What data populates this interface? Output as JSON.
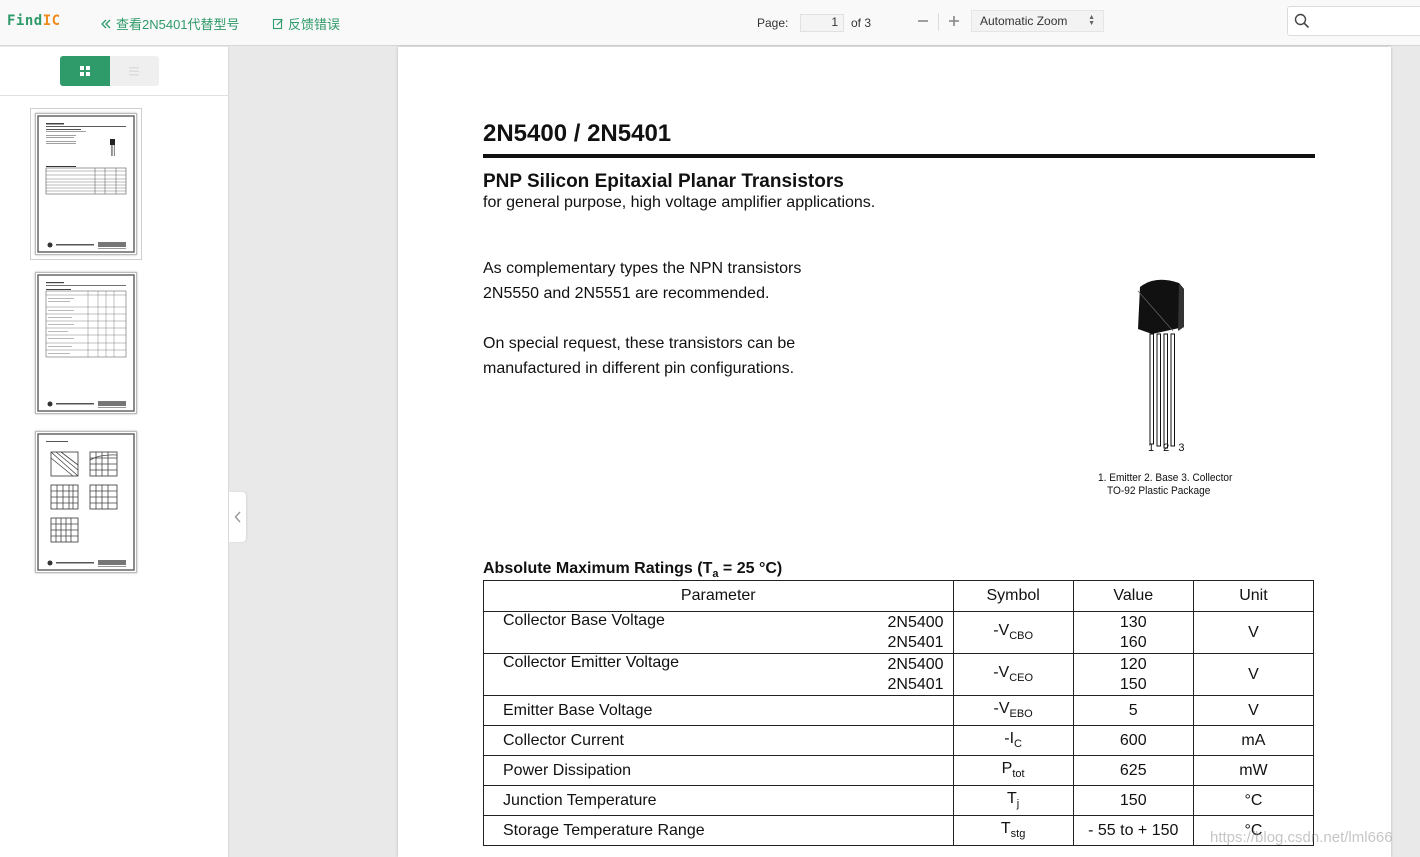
{
  "toolbar": {
    "logo_find": "Find",
    "logo_ic": "IC",
    "view_alternatives": "查看2N5401代替型号",
    "report_error": "反馈错误",
    "page_label": "Page:",
    "page_value": "1",
    "page_of": "of 3",
    "zoom_value": "Automatic Zoom"
  },
  "sidebar": {
    "thumbnails": [
      {
        "page": 1,
        "selected": true
      },
      {
        "page": 2,
        "selected": false
      },
      {
        "page": 3,
        "selected": false
      }
    ]
  },
  "document": {
    "title": "2N5400 / 2N5401",
    "subtitle": "PNP Silicon Epitaxial Planar Transistors",
    "description": "for general purpose, high voltage amplifier applications.",
    "para1_line1": "As complementary types the NPN transistors",
    "para1_line2": "2N5550 and 2N5551 are recommended.",
    "para2_line1": "On special request, these transistors can be",
    "para2_line2": "manufactured in different pin configurations.",
    "pin_numbers": "1 2 3",
    "package_caption_line1": "1. Emitter 2. Base 3. Collector",
    "package_caption_line2": "TO-92 Plastic Package",
    "ratings_title_prefix": "Absolute Maximum Ratings (T",
    "ratings_title_sub": "a",
    "ratings_title_suffix": " = 25 °C)",
    "table": {
      "headers": [
        "Parameter",
        "Symbol",
        "Value",
        "Unit"
      ],
      "rows": [
        {
          "parameter": "Collector Base Voltage",
          "variants": [
            "2N5400",
            "2N5401"
          ],
          "symbol": "-V",
          "symbol_sub": "CBO",
          "values": [
            "130",
            "160"
          ],
          "unit": "V"
        },
        {
          "parameter": "Collector Emitter Voltage",
          "variants": [
            "2N5400",
            "2N5401"
          ],
          "symbol": "-V",
          "symbol_sub": "CEO",
          "values": [
            "120",
            "150"
          ],
          "unit": "V"
        },
        {
          "parameter": "Emitter Base Voltage",
          "symbol": "-V",
          "symbol_sub": "EBO",
          "value": "5",
          "unit": "V"
        },
        {
          "parameter": "Collector Current",
          "symbol": "-I",
          "symbol_sub": "C",
          "value": "600",
          "unit": "mA"
        },
        {
          "parameter": "Power Dissipation",
          "symbol": "P",
          "symbol_sub": "tot",
          "value": "625",
          "unit": "mW"
        },
        {
          "parameter": "Junction Temperature",
          "symbol": "T",
          "symbol_sub": "j",
          "value": "150",
          "unit": "°C"
        },
        {
          "parameter": "Storage Temperature Range",
          "symbol": "T",
          "symbol_sub": "stg",
          "value": "- 55 to + 150",
          "unit": "°C"
        }
      ]
    }
  },
  "watermark": "https://blog.csdn.net/lml666"
}
